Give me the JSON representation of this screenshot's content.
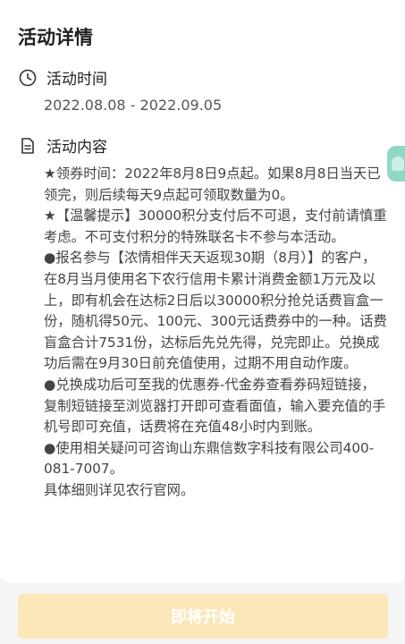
{
  "page": {
    "title": "活动详情"
  },
  "time_section": {
    "icon": "clock-icon",
    "label": "活动时间",
    "value": "2022.08.08 - 2022.09.05"
  },
  "content_section": {
    "icon": "document-icon",
    "label": "活动内容",
    "paragraphs": [
      "★领券时间：2022年8月8日9点起。如果8月8日当天已领完，则后续每天9点起可领取数量为0。",
      "★【温馨提示】30000积分支付后不可退，支付前请慎重考虑。不可支付积分的特殊联名卡不参与本活动。",
      "●报名参与【浓情相伴天天返现30期（8月）】的客户，在8月当月使用名下农行信用卡累计消费金额1万元及以上，即有机会在达标2日后以30000积分抢兑话费盲盒一份，随机得50元、100元、300元话费券中的一种。话费盲盒合计7531份，达标后先兑先得，兑完即止。兑换成功后需在9月30日前充值使用，过期不用自动作废。",
      "●兑换成功后可至我的优惠券-代金券查看券码短链接，复制短链接至浏览器打开即可查看面值，输入要充值的手机号即可充值，话费将在充值48小时内到账。",
      "●使用相关疑问可咨询山东鼎信数字科技有限公司400-081-7007。",
      "具体细则详见农行官网。"
    ]
  },
  "footer": {
    "button_label": "即将开始"
  },
  "colors": {
    "button_bg": "#fbe7b7",
    "side_tab": "#8fd8c7"
  }
}
